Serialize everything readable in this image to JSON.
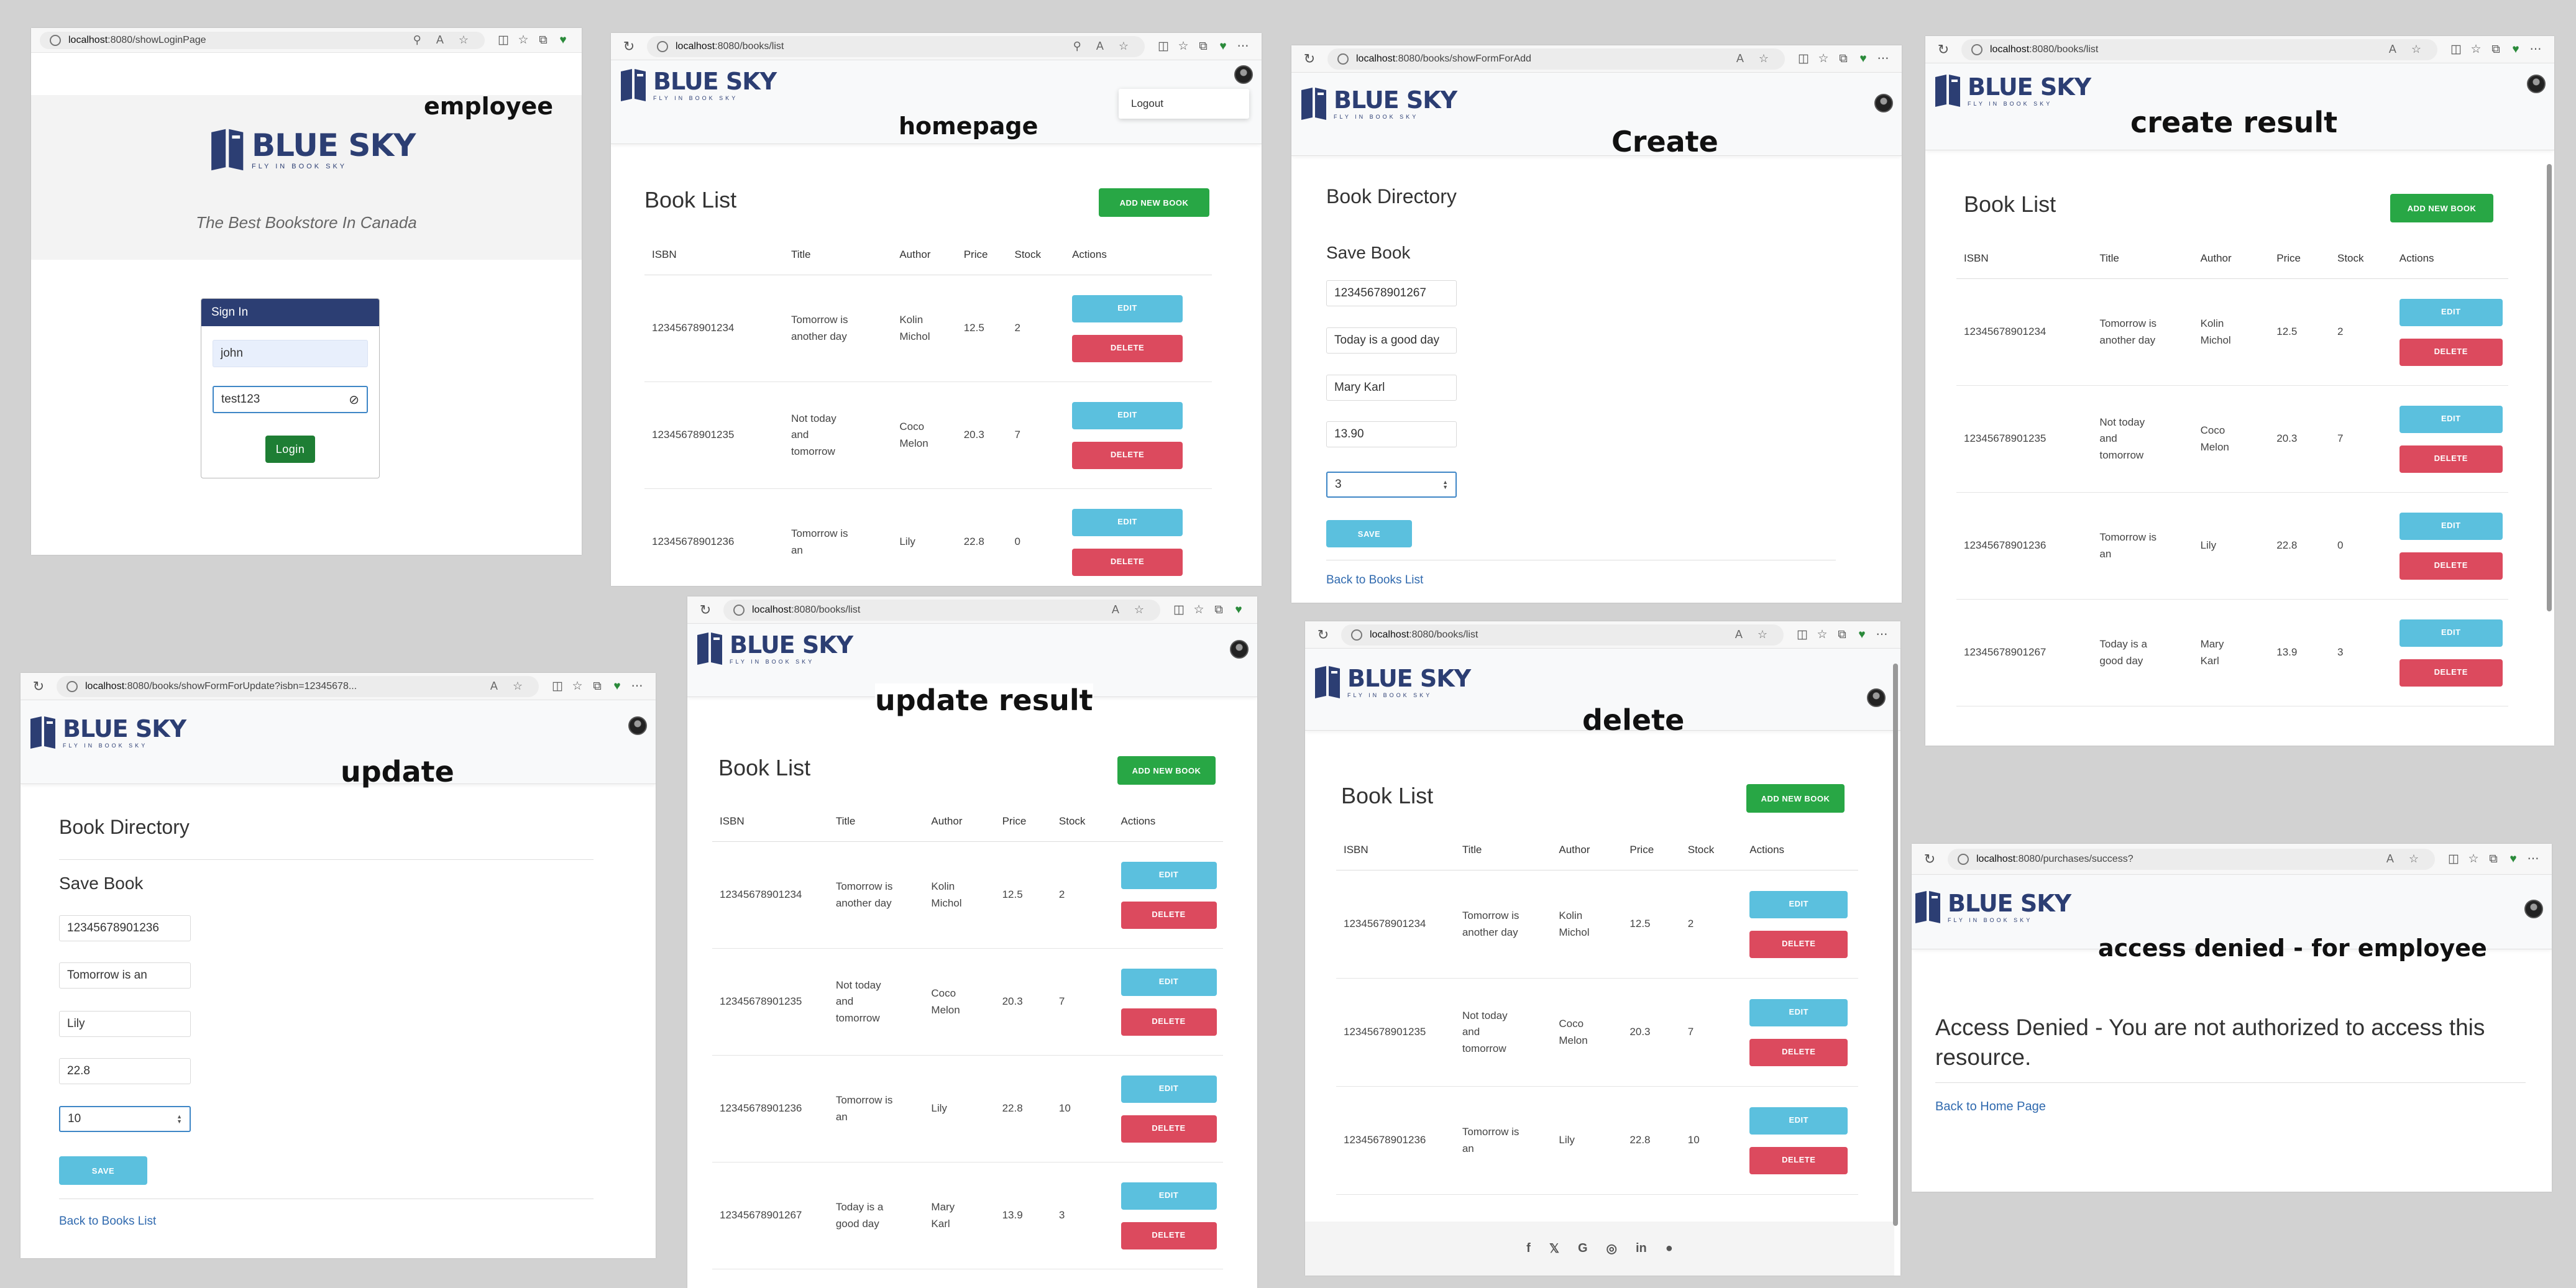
{
  "captions": {
    "employee": "employee",
    "homepage": "homepage",
    "create": "Create",
    "create_result": "create result",
    "update": "update",
    "update_result": "update result",
    "delete": "delete",
    "access_denied": "access denied  -  for employee"
  },
  "brand": {
    "name": "BLUE SKY",
    "tagline": "FLY IN BOOK SKY",
    "color": "#2c3e73"
  },
  "colors": {
    "green": "#28a745",
    "blue": "#5bc0de",
    "red": "#dc4a5e",
    "login_header": "#2c3e73",
    "login_button": "#1e7e34"
  },
  "urls": {
    "login_host": "localhost",
    "login_path": ":8080/showLoginPage",
    "home_host": "localhost",
    "home_path": ":8080/books/list",
    "create_host": "localhost",
    "create_path": ":8080/books/showFormForAdd",
    "create_result_host": "localhost",
    "create_result_path": ":8080/books/list",
    "update_host": "localhost",
    "update_path": ":8080/books/showFormForUpdate?isbn=12345678...",
    "update_result_host": "localhost",
    "update_result_path": ":8080/books/list",
    "delete_host": "localhost",
    "delete_path": ":8080/books/list",
    "denied_host": "localhost",
    "denied_path": ":8080/purchases/success?"
  },
  "login": {
    "slogan": "The Best Bookstore In Canada",
    "card_title": "Sign In",
    "username": "john",
    "password": "test123",
    "button": "Login"
  },
  "menu": {
    "logout": "Logout"
  },
  "book_list": {
    "title": "Book List",
    "add_button": "ADD NEW BOOK",
    "headers": [
      "ISBN",
      "Title",
      "Author",
      "Price",
      "Stock",
      "Actions"
    ],
    "edit": "EDIT",
    "delete": "DELETE"
  },
  "form": {
    "directory_title": "Book Directory",
    "save_title": "Save Book",
    "save_button": "SAVE",
    "back_link": "Back to Books List"
  },
  "create_form": {
    "isbn": "12345678901267",
    "title": "Today is a good day",
    "author": "Mary Karl",
    "price": "13.90",
    "stock": "3"
  },
  "update_form": {
    "isbn": "12345678901236",
    "title": "Tomorrow is an",
    "author": "Lily",
    "price": "22.8",
    "stock": "10"
  },
  "home_rows": [
    {
      "isbn": "12345678901234",
      "title": [
        "Tomorrow is",
        "another day"
      ],
      "author": [
        "Kolin",
        "Michol"
      ],
      "price": "12.5",
      "stock": "2"
    },
    {
      "isbn": "12345678901235",
      "title": [
        "Not today",
        "and",
        "tomorrow"
      ],
      "author": [
        "Coco",
        "Melon"
      ],
      "price": "20.3",
      "stock": "7"
    },
    {
      "isbn": "12345678901236",
      "title": [
        "Tomorrow is",
        "an"
      ],
      "author": [
        "Lily"
      ],
      "price": "22.8",
      "stock": "0"
    }
  ],
  "create_result_rows": [
    {
      "isbn": "12345678901234",
      "title": [
        "Tomorrow is",
        "another day"
      ],
      "author": [
        "Kolin",
        "Michol"
      ],
      "price": "12.5",
      "stock": "2"
    },
    {
      "isbn": "12345678901235",
      "title": [
        "Not today",
        "and",
        "tomorrow"
      ],
      "author": [
        "Coco",
        "Melon"
      ],
      "price": "20.3",
      "stock": "7"
    },
    {
      "isbn": "12345678901236",
      "title": [
        "Tomorrow is",
        "an"
      ],
      "author": [
        "Lily"
      ],
      "price": "22.8",
      "stock": "0"
    },
    {
      "isbn": "12345678901267",
      "title": [
        "Today is a",
        "good day"
      ],
      "author": [
        "Mary",
        "Karl"
      ],
      "price": "13.9",
      "stock": "3"
    }
  ],
  "update_result_rows": [
    {
      "isbn": "12345678901234",
      "title": [
        "Tomorrow is",
        "another day"
      ],
      "author": [
        "Kolin",
        "Michol"
      ],
      "price": "12.5",
      "stock": "2"
    },
    {
      "isbn": "12345678901235",
      "title": [
        "Not today",
        "and",
        "tomorrow"
      ],
      "author": [
        "Coco",
        "Melon"
      ],
      "price": "20.3",
      "stock": "7"
    },
    {
      "isbn": "12345678901236",
      "title": [
        "Tomorrow is",
        "an"
      ],
      "author": [
        "Lily"
      ],
      "price": "22.8",
      "stock": "10"
    },
    {
      "isbn": "12345678901267",
      "title": [
        "Today is a",
        "good day"
      ],
      "author": [
        "Mary",
        "Karl"
      ],
      "price": "13.9",
      "stock": "3"
    }
  ],
  "delete_rows": [
    {
      "isbn": "12345678901234",
      "title": [
        "Tomorrow is",
        "another day"
      ],
      "author": [
        "Kolin",
        "Michol"
      ],
      "price": "12.5",
      "stock": "2"
    },
    {
      "isbn": "12345678901235",
      "title": [
        "Not today",
        "and",
        "tomorrow"
      ],
      "author": [
        "Coco",
        "Melon"
      ],
      "price": "20.3",
      "stock": "7"
    },
    {
      "isbn": "12345678901236",
      "title": [
        "Tomorrow is",
        "an"
      ],
      "author": [
        "Lily"
      ],
      "price": "22.8",
      "stock": "10"
    }
  ],
  "footer_icons": [
    "facebook-icon",
    "twitter-icon",
    "google-icon",
    "instagram-icon",
    "linkedin-icon",
    "github-icon"
  ],
  "denied": {
    "message": "Access Denied - You are not authorized to access this resource.",
    "back_link": "Back to Home Page"
  }
}
